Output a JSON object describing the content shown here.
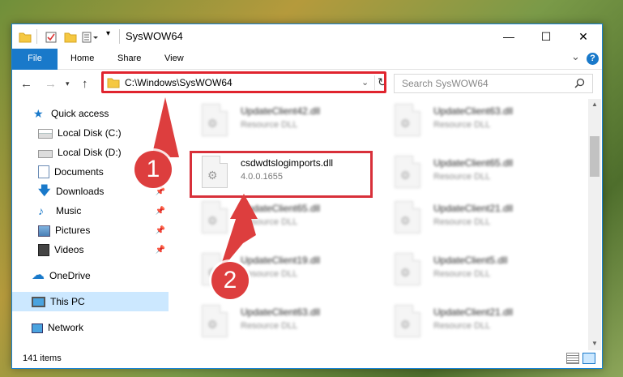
{
  "window": {
    "title": "SysWOW64",
    "minimize_glyph": "—",
    "maximize_glyph": "☐",
    "close_glyph": "✕"
  },
  "ribbon": {
    "tabs": [
      "File",
      "Home",
      "Share",
      "View"
    ],
    "help_glyph": "?",
    "expand_glyph": "⌄"
  },
  "address": {
    "path": "C:\\Windows\\SysWOW64",
    "search_placeholder": "Search SysWOW64"
  },
  "sidebar": {
    "items": [
      {
        "label": "Quick access",
        "icon": "star-icon"
      },
      {
        "label": "Local Disk (C:)",
        "icon": "drive-icon"
      },
      {
        "label": "Local Disk (D:)",
        "icon": "drive-icon"
      },
      {
        "label": "Documents",
        "icon": "documents-icon"
      },
      {
        "label": "Downloads",
        "icon": "download-icon"
      },
      {
        "label": "Music",
        "icon": "music-icon"
      },
      {
        "label": "Pictures",
        "icon": "pictures-icon"
      },
      {
        "label": "Videos",
        "icon": "videos-icon"
      },
      {
        "label": "OneDrive",
        "icon": "cloud-icon"
      },
      {
        "label": "This PC",
        "icon": "computer-icon"
      },
      {
        "label": "Network",
        "icon": "network-icon"
      }
    ]
  },
  "files": {
    "left": [
      {
        "name": "UpdateClient42.dll",
        "desc": "Resource DLL"
      },
      {
        "name": "csdwdtslogimports.dll",
        "desc": "4.0.0.1655"
      },
      {
        "name": "UpdateClient65.dll",
        "desc": "Resource DLL"
      },
      {
        "name": "UpdateClient19.dll",
        "desc": "Resource DLL"
      },
      {
        "name": "UpdateClient63.dll",
        "desc": "Resource DLL"
      }
    ],
    "right": [
      {
        "name": "UpdateClient63.dll",
        "desc": "Resource DLL"
      },
      {
        "name": "UpdateClient65.dll",
        "desc": "Resource DLL"
      },
      {
        "name": "UpdateClient21.dll",
        "desc": "Resource DLL"
      },
      {
        "name": "UpdateClient5.dll",
        "desc": "Resource DLL"
      },
      {
        "name": "UpdateClient21.dll",
        "desc": "Resource DLL"
      }
    ]
  },
  "status": {
    "item_count": "141 items"
  },
  "annotations": {
    "step1": "1",
    "step2": "2",
    "color": "#dd3e3e"
  }
}
